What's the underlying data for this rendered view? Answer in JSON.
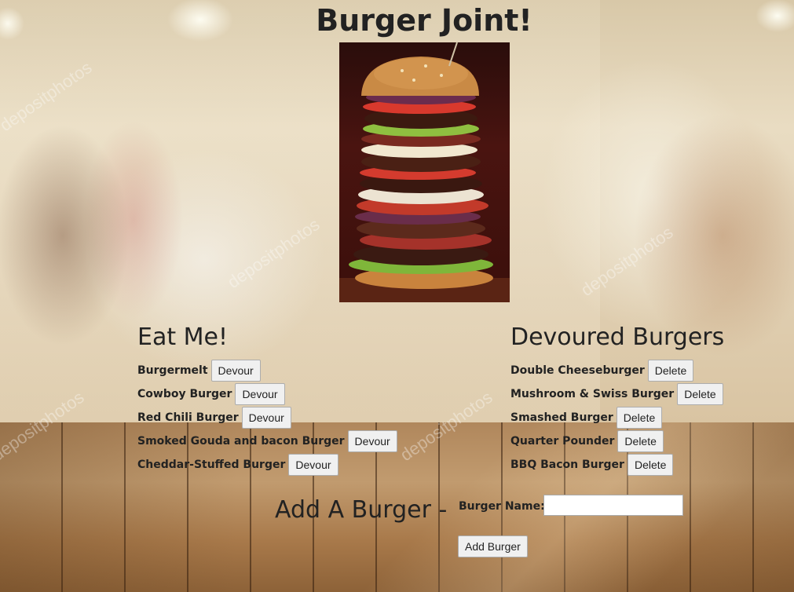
{
  "page": {
    "title": "Burger Joint!"
  },
  "uneaten": {
    "heading": "Eat Me!",
    "button_label": "Devour",
    "items": [
      "Burgermelt",
      "Cowboy Burger",
      "Red Chili Burger",
      "Smoked Gouda and bacon Burger",
      "Cheddar-Stuffed Burger"
    ]
  },
  "devoured": {
    "heading": "Devoured Burgers",
    "button_label": "Delete",
    "items": [
      "Double Cheeseburger",
      "Mushroom & Swiss Burger",
      "Smashed Burger",
      "Quarter Pounder",
      "BBQ Bacon Burger"
    ]
  },
  "add_form": {
    "heading": "Add A Burger -",
    "name_label": "Burger Name:",
    "name_value": "",
    "submit_label": "Add Burger"
  },
  "watermark_text": "depositphotos"
}
